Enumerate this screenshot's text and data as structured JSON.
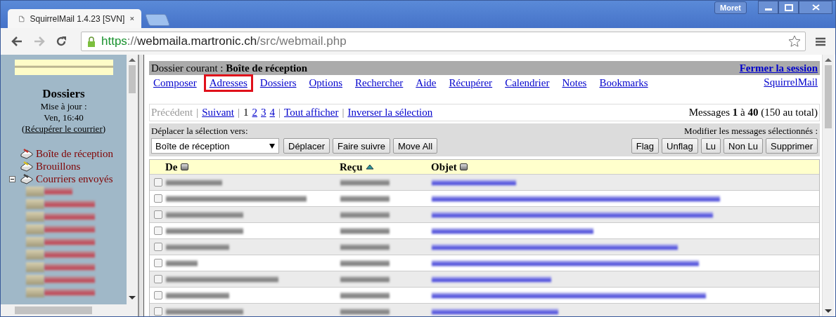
{
  "browser": {
    "tab_title": "SquirrelMail 1.4.23 [SVN]",
    "user": "Moret",
    "url": {
      "scheme": "https",
      "separator": "://",
      "host": "webmaila.martronic.ch",
      "path": "/src/webmail.php"
    }
  },
  "sidebar": {
    "heading": "Dossiers",
    "updated_label": "Mise à jour :",
    "updated_time": "Ven, 16:40",
    "refresh_prefix": "(",
    "refresh_link": "Récupérer le courrier",
    "refresh_suffix": ")",
    "folders": [
      {
        "name": "Boîte de réception",
        "kind": "inbox"
      },
      {
        "name": "Brouillons",
        "kind": "drafts"
      },
      {
        "name": "Courriers envoyés",
        "kind": "sent",
        "expanded": true
      }
    ],
    "subfolders": [
      {
        "kind": "redacted"
      },
      {
        "kind": "redacted"
      },
      {
        "kind": "redacted"
      },
      {
        "kind": "redacted"
      },
      {
        "kind": "redacted"
      },
      {
        "kind": "redacted"
      },
      {
        "kind": "redacted"
      },
      {
        "kind": "redacted"
      },
      {
        "kind": "redacted"
      }
    ]
  },
  "header": {
    "current_folder": "Dossier courant : **Boîte de réception**",
    "logout": "Fermer la session"
  },
  "nav": [
    {
      "label": "Composer",
      "highlighted": false
    },
    {
      "label": "Adresses",
      "highlighted": true
    },
    {
      "label": "Dossiers",
      "highlighted": false
    },
    {
      "label": "Options",
      "highlighted": false
    },
    {
      "label": "Rechercher",
      "highlighted": false
    },
    {
      "label": "Aide",
      "highlighted": false
    },
    {
      "label": "Récupérer",
      "highlighted": false
    },
    {
      "label": "Calendrier",
      "highlighted": false
    },
    {
      "label": "Notes",
      "highlighted": false
    },
    {
      "label": "Bookmarks",
      "highlighted": false
    }
  ],
  "brand_link": "SquirrelMail",
  "pager": {
    "previous": {
      "label": "Précédent",
      "disabled": true
    },
    "next": {
      "label": "Suivant",
      "disabled": false
    },
    "pages": [
      {
        "label": "1",
        "selected": true
      },
      {
        "label": "2",
        "selected": false
      },
      {
        "label": "3",
        "selected": false
      },
      {
        "label": "4",
        "selected": false
      }
    ],
    "show_all": "Tout afficher",
    "invert": "Inverser la sélection",
    "separator": "|",
    "summary": "Messages **1** à **40** (150 au total)"
  },
  "move_bar": {
    "label": "Déplacer la sélection vers:",
    "folder_select": "Boîte de réception",
    "buttons": [
      "Déplacer",
      "Faire suivre",
      "Move All"
    ],
    "modify_label": "Modifier les messages sélectionnés :",
    "modify_buttons": [
      "Flag",
      "Unflag",
      "Lu",
      "Non Lu",
      "Supprimer"
    ]
  },
  "table": {
    "columns": [
      {
        "label": "De",
        "sorted": false
      },
      {
        "label": "Reçu",
        "sorted": true
      },
      {
        "label": "Objet",
        "sorted": false
      }
    ],
    "rows": [
      {
        "checked": false
      },
      {
        "checked": false
      },
      {
        "checked": false
      },
      {
        "checked": false
      },
      {
        "checked": false
      },
      {
        "checked": false
      },
      {
        "checked": false
      },
      {
        "checked": false
      },
      {
        "checked": false
      }
    ]
  }
}
